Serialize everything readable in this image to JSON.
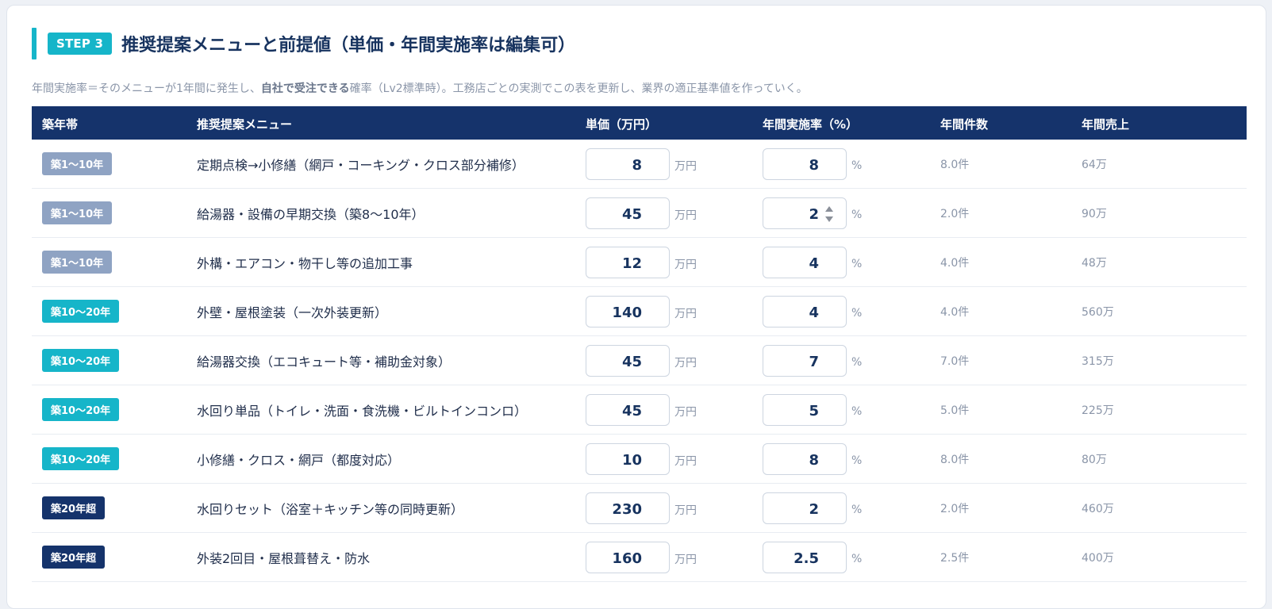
{
  "step": {
    "badge": "STEP 3",
    "title": "推奨提案メニューと前提値（単価・年間実施率は編集可）"
  },
  "description": {
    "prefix": "年間実施率＝そのメニューが1年間に発生し、",
    "bold": "自社で受注できる",
    "suffix": "確率（Lv2標準時）。工務店ごとの実測でこの表を更新し、業界の適正基準値を作っていく。"
  },
  "table": {
    "headers": {
      "age": "築年帯",
      "menu": "推奨提案メニュー",
      "price": "単価（万円）",
      "rate": "年間実施率（%）",
      "count": "年間件数",
      "sales": "年間売上"
    },
    "price_unit": "万円",
    "rate_unit": "%",
    "rows": [
      {
        "age": "築1〜10年",
        "age_tone": "gray",
        "menu": "定期点検→小修繕（網戸・コーキング・クロス部分補修）",
        "price": "8",
        "rate": "8",
        "count": "8.0件",
        "sales": "64万"
      },
      {
        "age": "築1〜10年",
        "age_tone": "gray",
        "menu": "給湯器・設備の早期交換（築8〜10年）",
        "price": "45",
        "rate": "2",
        "count": "2.0件",
        "sales": "90万"
      },
      {
        "age": "築1〜10年",
        "age_tone": "gray",
        "menu": "外構・エアコン・物干し等の追加工事",
        "price": "12",
        "rate": "4",
        "count": "4.0件",
        "sales": "48万"
      },
      {
        "age": "築10〜20年",
        "age_tone": "teal",
        "menu": "外壁・屋根塗装（一次外装更新）",
        "price": "140",
        "rate": "4",
        "count": "4.0件",
        "sales": "560万"
      },
      {
        "age": "築10〜20年",
        "age_tone": "teal",
        "menu": "給湯器交換（エコキュート等・補助金対象）",
        "price": "45",
        "rate": "7",
        "count": "7.0件",
        "sales": "315万"
      },
      {
        "age": "築10〜20年",
        "age_tone": "teal",
        "menu": "水回り単品（トイレ・洗面・食洗機・ビルトインコンロ）",
        "price": "45",
        "rate": "5",
        "count": "5.0件",
        "sales": "225万"
      },
      {
        "age": "築10〜20年",
        "age_tone": "teal",
        "menu": "小修繕・クロス・網戸（都度対応）",
        "price": "10",
        "rate": "8",
        "count": "8.0件",
        "sales": "80万"
      },
      {
        "age": "築20年超",
        "age_tone": "navy",
        "menu": "水回りセット（浴室＋キッチン等の同時更新）",
        "price": "230",
        "rate": "2",
        "count": "2.0件",
        "sales": "460万"
      },
      {
        "age": "築20年超",
        "age_tone": "navy",
        "menu": "外装2回目・屋根葺替え・防水",
        "price": "160",
        "rate": "2.5",
        "count": "2.5件",
        "sales": "400万"
      }
    ]
  },
  "colors": {
    "accent": "#16b5c9",
    "header_bg": "#15336b",
    "badge_gray": "#8fa3c3"
  }
}
